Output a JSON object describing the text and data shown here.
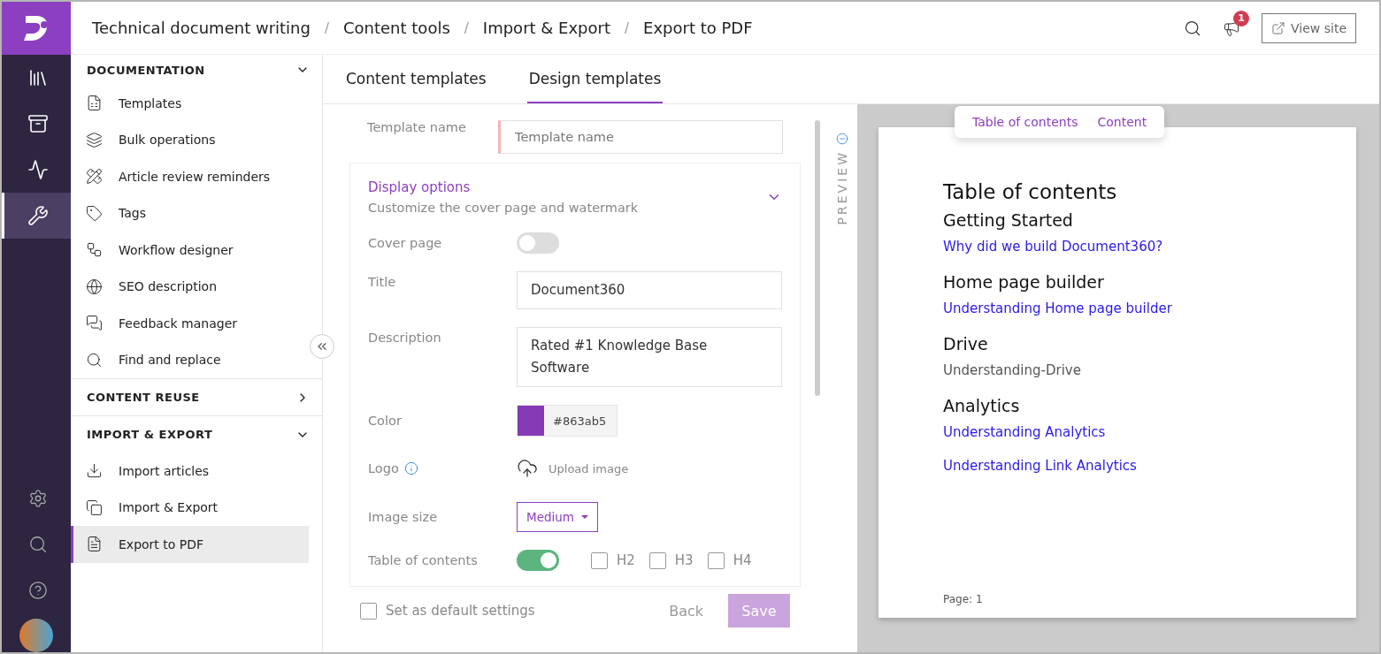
{
  "rail": {
    "items": [
      {
        "selected": false
      },
      {
        "selected": false
      },
      {
        "selected": false
      },
      {
        "selected": true
      }
    ]
  },
  "breadcrumb": {
    "separator": "/",
    "items": [
      "Technical document writing",
      "Content tools",
      "Import & Export",
      "Export to PDF"
    ]
  },
  "topbar": {
    "notification_count": "1",
    "view_site": "View site"
  },
  "sidebar": {
    "sections": [
      {
        "title": "DOCUMENTATION",
        "expanded": true,
        "items": [
          {
            "label": "Templates",
            "selected": false
          },
          {
            "label": "Bulk operations",
            "selected": false
          },
          {
            "label": "Article review reminders",
            "selected": false
          },
          {
            "label": "Tags",
            "selected": false
          },
          {
            "label": "Workflow designer",
            "selected": false
          },
          {
            "label": "SEO description",
            "selected": false
          },
          {
            "label": "Feedback manager",
            "selected": false
          },
          {
            "label": "Find and replace",
            "selected": false
          }
        ]
      },
      {
        "title": "CONTENT REUSE",
        "expanded": false
      },
      {
        "title": "IMPORT & EXPORT",
        "expanded": true,
        "items": [
          {
            "label": "Import articles",
            "selected": false
          },
          {
            "label": "Import & Export",
            "selected": false
          },
          {
            "label": "Export to PDF",
            "selected": true
          }
        ]
      }
    ]
  },
  "tabs": [
    {
      "label": "Content templates",
      "selected": false
    },
    {
      "label": "Design templates",
      "selected": true
    }
  ],
  "form": {
    "template_name": {
      "label": "Template name",
      "placeholder": "Template name"
    },
    "section": {
      "title": "Display options",
      "subtitle": "Customize the cover page and watermark",
      "expanded": true
    },
    "cover_page": {
      "label": "Cover page",
      "on": false
    },
    "title": {
      "label": "Title",
      "value": "Document360"
    },
    "description": {
      "label": "Description",
      "value": "Rated #1 Knowledge Base Software"
    },
    "color": {
      "label": "Color",
      "value": "#863ab5",
      "color": "#863ab5"
    },
    "logo": {
      "label": "Logo",
      "upload": "Upload image"
    },
    "image_size": {
      "label": "Image size",
      "value": "Medium"
    },
    "toc": {
      "label": "Table of contents",
      "on": true,
      "levels": [
        {
          "label": "H2",
          "checked": false
        },
        {
          "label": "H3",
          "checked": false
        },
        {
          "label": "H4",
          "checked": false
        }
      ]
    },
    "default_settings": {
      "label": "Set as default settings",
      "checked": false
    },
    "back": "Back",
    "save": {
      "label": "Save",
      "disabled": true
    }
  },
  "preview": {
    "label": "PREVIEW",
    "tabs": [
      {
        "label": "Table of contents"
      },
      {
        "label": "Content"
      }
    ],
    "page": {
      "title": "Table of contents",
      "entries": [
        {
          "kind": "heading",
          "text": "Getting Started"
        },
        {
          "kind": "link",
          "text": "Why did we build Document360?"
        },
        {
          "kind": "heading",
          "text": "Home page builder"
        },
        {
          "kind": "link",
          "text": "Understanding Home page builder"
        },
        {
          "kind": "heading",
          "text": "Drive"
        },
        {
          "kind": "text",
          "text": "Understanding-Drive"
        },
        {
          "kind": "heading",
          "text": "Analytics"
        },
        {
          "kind": "link",
          "text": "Understanding Analytics"
        },
        {
          "kind": "link",
          "text": "Understanding Link Analytics"
        }
      ],
      "footer": "Page: 1"
    }
  }
}
